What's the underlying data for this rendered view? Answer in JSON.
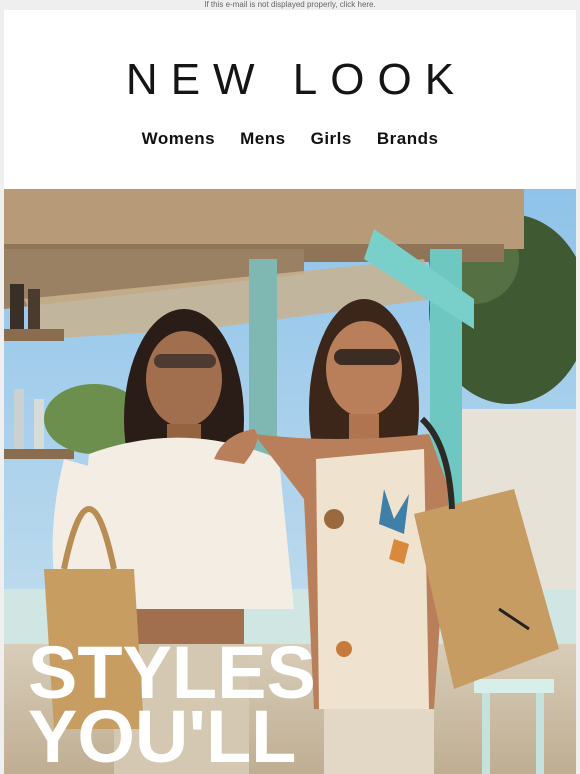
{
  "preheader": {
    "text": "If this e-mail is not displayed properly, click here."
  },
  "brand": {
    "logo_text": "NEW LOOK"
  },
  "nav": {
    "items": [
      {
        "label": "Womens"
      },
      {
        "label": "Mens"
      },
      {
        "label": "Girls"
      },
      {
        "label": "Brands"
      }
    ]
  },
  "hero": {
    "headline_line1": "STYLES",
    "headline_line2": "YOU'LL"
  },
  "colors": {
    "text_dark": "#111111",
    "headline": "#ffffff",
    "page_bg": "#efefef",
    "card_bg": "#ffffff"
  }
}
